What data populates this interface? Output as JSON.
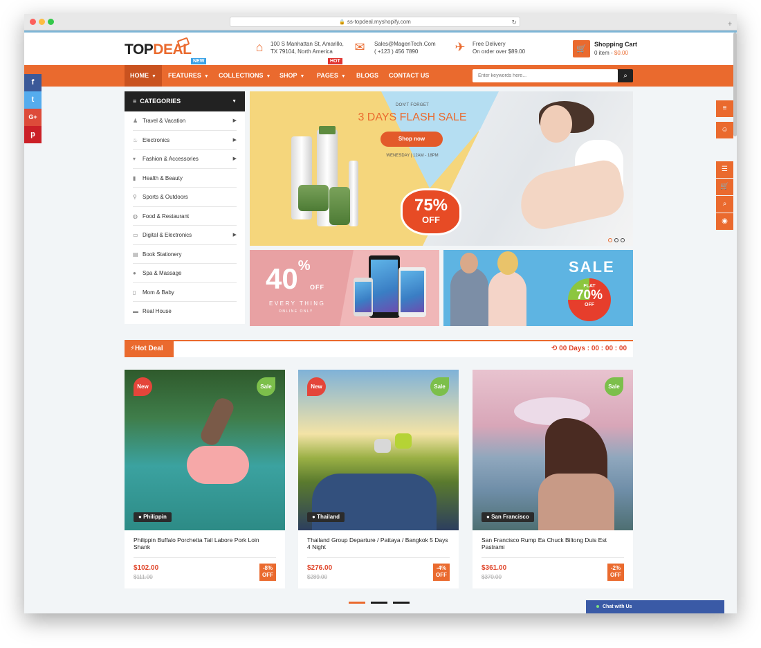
{
  "browser": {
    "url": "ss-topdeal.myshopify.com"
  },
  "header": {
    "logo_top": "TOP",
    "logo_deal": "DEAL",
    "logo_badge": "NEW",
    "address_line1": "100 S Manhattan St, Amarillo,",
    "address_line2": "TX 79104, North America",
    "email_line1": "Sales@MagenTech.Com",
    "email_line2": "( +123 ) 456 7890",
    "delivery_line1": "Free Delivery",
    "delivery_line2": "On order over $89.00",
    "cart_title": "Shopping Cart",
    "cart_items": "0 item - ",
    "cart_price": "$0.00"
  },
  "nav": {
    "items": [
      "HOME",
      "FEATURES",
      "COLLECTIONS",
      "SHOP",
      "PAGES",
      "BLOGS",
      "CONTACT US"
    ],
    "hot_badge": "HOT",
    "search_placeholder": "Enter keywords here..."
  },
  "social": [
    "f",
    "t",
    "G+",
    "p"
  ],
  "categories": {
    "title": "CATEGORIES",
    "items": [
      "Travel & Vacation",
      "Electronics",
      "Fashion & Accessories",
      "Health & Beauty",
      "Sports & Outdoors",
      "Food & Restaurant",
      "Digital & Electronics",
      "Book Stationery",
      "Spa & Massage",
      "Mom & Baby",
      "Real House"
    ]
  },
  "slider": {
    "kicker": "DON'T FORGET",
    "title": "3 DAYS FLASH SALE",
    "button": "Shop now",
    "time": "WENESDAY | 12AM - 18PM",
    "burst_pct": "75%",
    "burst_off": "OFF"
  },
  "banner_left": {
    "pct": "40",
    "pct_sign": "%",
    "off": "OFF",
    "every": "EVERY THING",
    "online": "ONLINE ONLY"
  },
  "banner_right": {
    "sale": "SALE",
    "flat": "FLAT",
    "pct": "70%",
    "off": "OFF"
  },
  "hot_deal": {
    "label": "Hot Deal",
    "timer": "00 Days : 00 : 00 : 00"
  },
  "products": [
    {
      "tag_new": "New",
      "tag_sale": "Sale",
      "location": "Philippin",
      "title": "Philippin Buffalo Porchetta Tail Labore Pork Loin Shank",
      "price": "$102.00",
      "old_price": "$111.00",
      "discount_pct": "-8%",
      "discount_off": "OFF"
    },
    {
      "tag_new": "New",
      "tag_sale": "Sale",
      "location": "Thailand",
      "title": "Thailand Group Departure / Pattaya / Bangkok 5 Days 4 Night",
      "price": "$276.00",
      "old_price": "$289.00",
      "discount_pct": "-4%",
      "discount_off": "OFF"
    },
    {
      "tag_sale": "Sale",
      "location": "San Francisco",
      "title": "San Francisco Rump Ea Chuck Biltong Duis Est Pastrami",
      "price": "$361.00",
      "old_price": "$370.00",
      "discount_pct": "-2%",
      "discount_off": "OFF"
    }
  ],
  "chat": {
    "label": "Chat with Us"
  },
  "colors": {
    "accent": "#ea6a2e",
    "dark": "#222222",
    "facebook": "#3b5998",
    "twitter": "#55acee",
    "google": "#dd4b39",
    "pinterest": "#cb2027"
  }
}
